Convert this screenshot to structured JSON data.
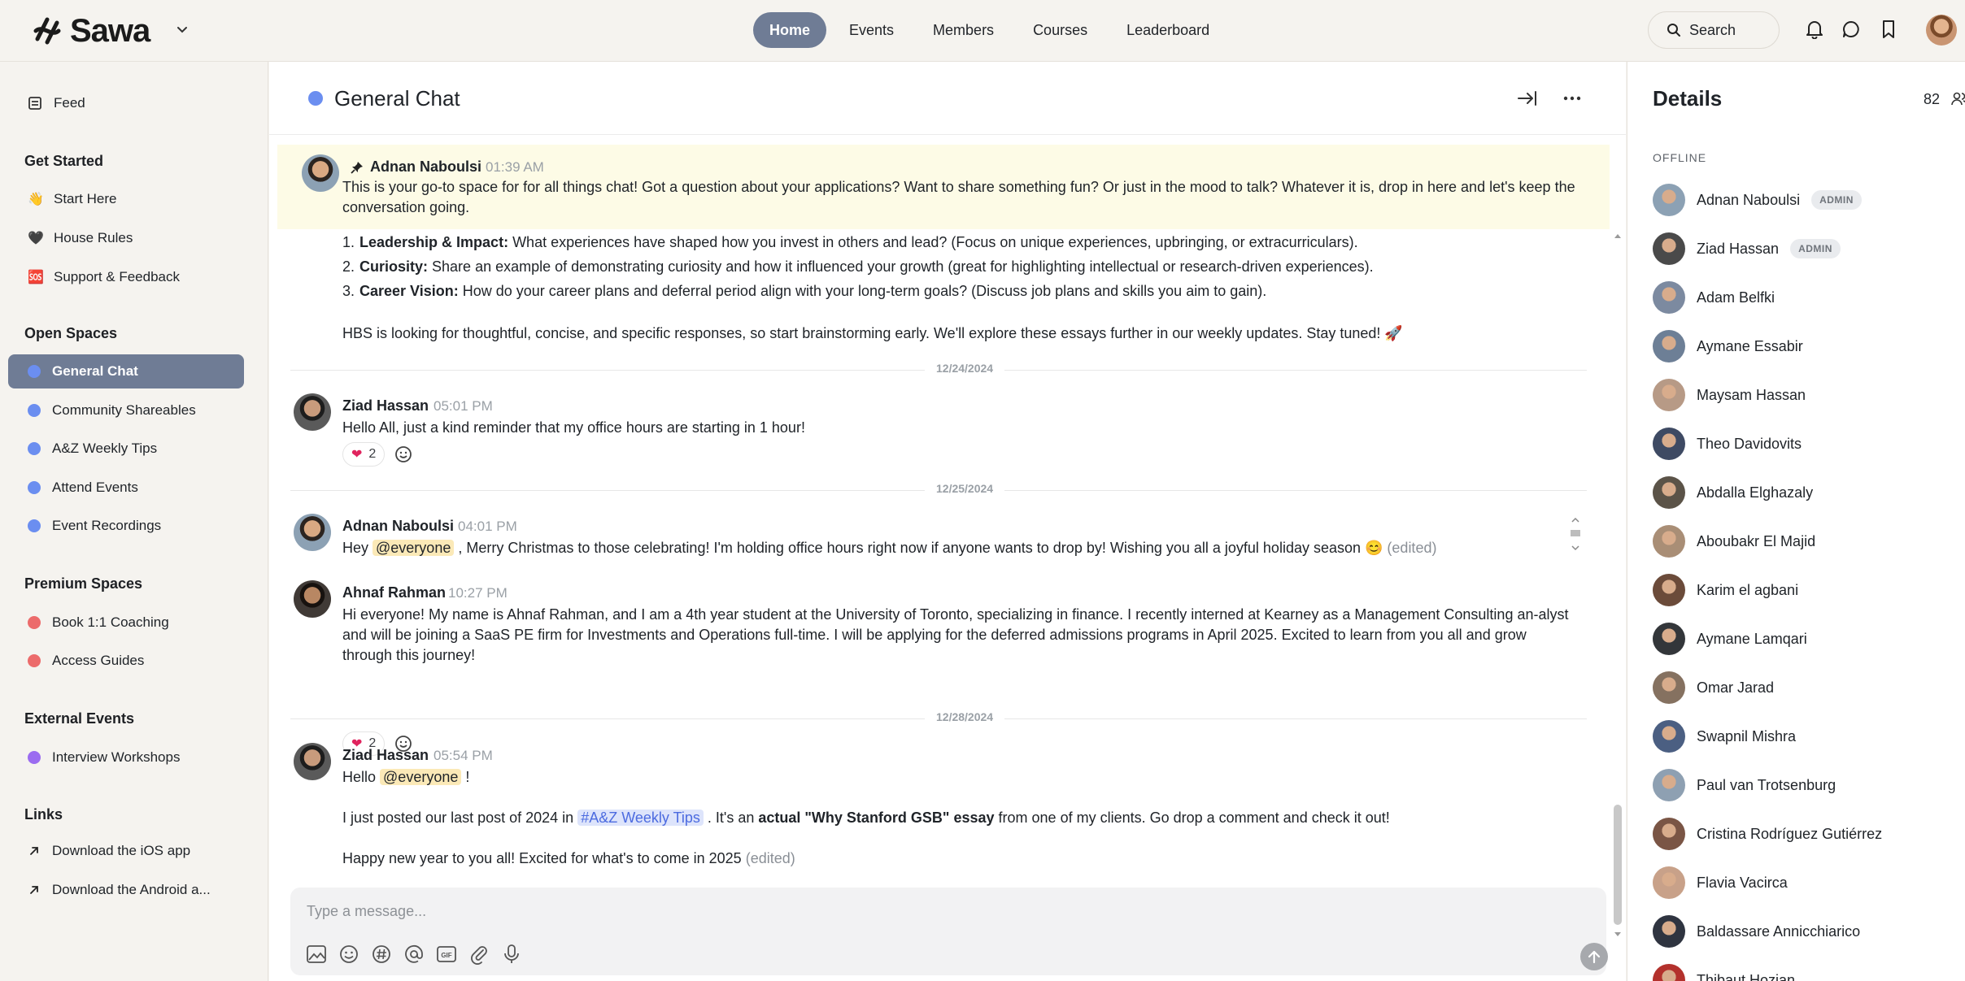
{
  "brand": {
    "name": "Sawa"
  },
  "nav": {
    "items": [
      "Home",
      "Events",
      "Members",
      "Courses",
      "Leaderboard"
    ],
    "active": "Home"
  },
  "search": {
    "label": "Search"
  },
  "colors": {
    "accent": "#6f7c95",
    "channel_blue": "#6b8ef0",
    "channel_red": "#ec6b6b",
    "channel_purple": "#9b6cf0",
    "pinned_bg": "#fdfbe6",
    "mention_bg": "#fbe9b7"
  },
  "sidebar": {
    "feed": "Feed",
    "get_started": {
      "title": "Get Started",
      "items": [
        {
          "label": "Start Here",
          "icon": "👋"
        },
        {
          "label": "House Rules",
          "icon": "🖤"
        },
        {
          "label": "Support & Feedback",
          "icon": "🆘"
        }
      ]
    },
    "open_spaces": {
      "title": "Open Spaces",
      "items": [
        "General Chat",
        "Community Shareables",
        "A&Z Weekly Tips",
        "Attend Events",
        "Event Recordings"
      ]
    },
    "premium_spaces": {
      "title": "Premium Spaces",
      "items": [
        "Book 1:1 Coaching",
        "Access Guides"
      ]
    },
    "external_events": {
      "title": "External Events",
      "items": [
        "Interview Workshops"
      ]
    },
    "links": {
      "title": "Links",
      "items": [
        "Download the iOS app",
        "Download the Android a..."
      ]
    }
  },
  "chat": {
    "title": "General Chat",
    "pinned": {
      "author": "Adnan Naboulsi",
      "time": "01:39 AM",
      "text": "This is your go-to space for for all things chat! Got a question about your applications? Want to share something fun? Or just in the mood to talk? Whatever it is, drop in here and let's keep the conversation going."
    },
    "list_items": [
      {
        "title": "Leadership & Impact:",
        "text": " What experiences have shaped how you invest in others and lead? (Focus on unique experiences, upbringing, or extracurriculars)."
      },
      {
        "title": "Curiosity:",
        "text": " Share an example of demonstrating curiosity and how it influenced your growth (great for highlighting intellectual or research-driven experiences)."
      },
      {
        "title": "Career Vision:",
        "text": " How do your career plans and deferral period align with your long-term goals? (Discuss job plans and skills you aim to gain)."
      }
    ],
    "hbs_text": "HBS is looking for thoughtful, concise, and specific responses, so start brainstorming early. We'll explore these essays further in our weekly updates. Stay tuned! 🚀",
    "dates": [
      "12/24/2024",
      "12/25/2024",
      "12/28/2024"
    ],
    "m1": {
      "author": "Ziad Hassan",
      "time": "05:01 PM",
      "text": "Hello All, just a kind reminder that my office hours are starting in 1 hour!",
      "reaction": "2"
    },
    "m2": {
      "author": "Adnan Naboulsi",
      "time": "04:01 PM",
      "pre": "Hey ",
      "mention": "@everyone",
      "post": " , Merry Christmas to those celebrating! I'm holding office hours right now if anyone wants to drop by! Wishing you all a joyful holiday season 😊 ",
      "edited": "(edited)"
    },
    "m3": {
      "author": "Ahnaf Rahman",
      "time": "10:27 PM",
      "text": "Hi everyone! My name is Ahnaf Rahman, and I am a 4th year student at the University of Toronto, specializing in finance. I recently interned at Kearney as a Management Consulting an-alyst and will be joining a SaaS PE firm for Investments and Operations full-time. I will be applying for the deferred admissions programs in April 2025. Excited to learn from you all and grow through this journey!",
      "reaction": "2"
    },
    "m4": {
      "author": "Ziad Hassan",
      "time": "05:54 PM",
      "hello": "Hello ",
      "mention": "@everyone",
      "bang": " !",
      "p1_pre": "I just posted our last post of 2024 in ",
      "channel": "#A&Z Weekly Tips",
      "p1_mid": " . It's an ",
      "p1_bold": "actual \"Why Stanford GSB\" essay",
      "p1_post": " from one of my clients. Go drop a comment and check it out!",
      "p2": "Happy new year to you all! Excited for what's to come in 2025 ",
      "edited": "(edited)"
    },
    "composer": {
      "placeholder": "Type a message..."
    }
  },
  "details": {
    "title": "Details",
    "count": "82",
    "offline_label": "OFFLINE",
    "admin_badge": "ADMIN",
    "members": [
      {
        "name": "Adnan Naboulsi",
        "admin": true,
        "color": "#8ca1b4"
      },
      {
        "name": "Ziad Hassan",
        "admin": true,
        "color": "#4a4a4a"
      },
      {
        "name": "Adam Belfki",
        "admin": false,
        "color": "#7c8aa0"
      },
      {
        "name": "Aymane Essabir",
        "admin": false,
        "color": "#6d7f96"
      },
      {
        "name": "Maysam Hassan",
        "admin": false,
        "color": "#b79a86"
      },
      {
        "name": "Theo Davidovits",
        "admin": false,
        "color": "#3e4a63"
      },
      {
        "name": "Abdalla Elghazaly",
        "admin": false,
        "color": "#5b5348"
      },
      {
        "name": "Aboubakr El Majid",
        "admin": false,
        "color": "#a98e76"
      },
      {
        "name": "Karim el agbani",
        "admin": false,
        "color": "#6b4b3a"
      },
      {
        "name": "Aymane Lamqari",
        "admin": false,
        "color": "#33363a"
      },
      {
        "name": "Omar Jarad",
        "admin": false,
        "color": "#857160"
      },
      {
        "name": "Swapnil Mishra",
        "admin": false,
        "color": "#4b5f82"
      },
      {
        "name": "Paul van Trotsenburg",
        "admin": false,
        "color": "#8ea0b2"
      },
      {
        "name": "Cristina Rodríguez Gutiérrez",
        "admin": false,
        "color": "#7a5545"
      },
      {
        "name": "Flavia Vacirca",
        "admin": false,
        "color": "#c8a189"
      },
      {
        "name": "Baldassare Annicchiarico",
        "admin": false,
        "color": "#2f3440"
      },
      {
        "name": "Thibaut Hozian",
        "admin": false,
        "color": "#b3312c"
      }
    ]
  }
}
